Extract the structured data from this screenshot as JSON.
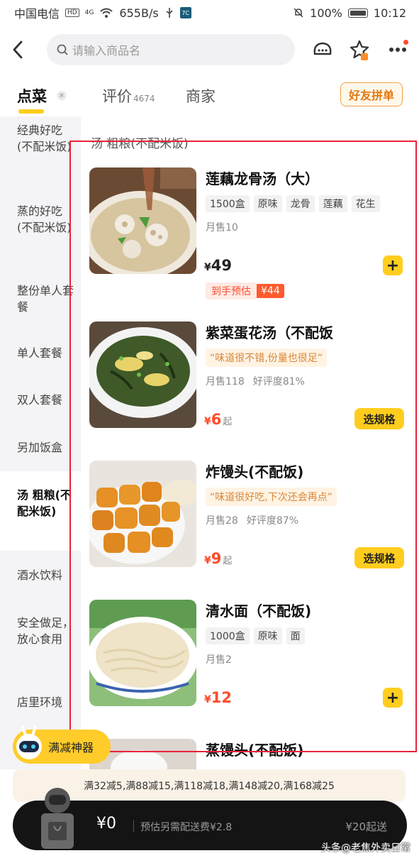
{
  "status_bar": {
    "carrier": "中国电信",
    "hd": "HD",
    "signal_label": "4G",
    "speed": "655B/s",
    "battery": "100%",
    "time": "10:12"
  },
  "search": {
    "placeholder": "请输入商品名"
  },
  "tabs": [
    {
      "label": "点菜"
    },
    {
      "label": "评价",
      "count": "4674"
    },
    {
      "label": "商家"
    }
  ],
  "tab_mini_badge": "不",
  "group_order_label": "好友拼单",
  "sidebar": {
    "items": [
      {
        "label": "经典好吃(不配米饭)"
      },
      {
        "label": "蒸的好吃(不配米饭)"
      },
      {
        "label": "整份单人套餐"
      },
      {
        "label": "单人套餐"
      },
      {
        "label": "双人套餐"
      },
      {
        "label": "另加饭盒"
      },
      {
        "label": "汤 粗粮(不配米饭)",
        "active": true
      },
      {
        "label": "酒水饮料"
      },
      {
        "label": "安全做足，放心食用"
      },
      {
        "label": "店里环境"
      }
    ]
  },
  "section_title": "汤 粗粮(不配米饭)",
  "dishes": [
    {
      "name": "莲藕龙骨汤（大）",
      "tags": [
        "1500盒",
        "原味",
        "龙骨",
        "莲藕",
        "花生"
      ],
      "sales": "月售10",
      "currency": "¥",
      "price": "49",
      "estimate_label": "到手预估",
      "estimate_price": "¥44",
      "action": "plus",
      "image_icon": "lotus-soup-image"
    },
    {
      "name": "紫菜蛋花汤（不配饭",
      "quote": "“味道很不错,份量也很足”",
      "sales": "月售118",
      "rating": "好评度81%",
      "currency": "¥",
      "price": "6",
      "from": "起",
      "action_label": "选规格",
      "image_icon": "seaweed-egg-soup-image"
    },
    {
      "name": "炸馒头(不配饭)",
      "quote": "“味道很好吃,下次还会再点”",
      "sales": "月售28",
      "rating": "好评度87%",
      "currency": "¥",
      "price": "9",
      "from": "起",
      "action_label": "选规格",
      "image_icon": "fried-bun-image"
    },
    {
      "name": "清水面（不配饭)",
      "tags": [
        "1000盒",
        "原味",
        "面"
      ],
      "sales": "月售2",
      "currency": "¥",
      "price": "12",
      "action": "plus",
      "image_icon": "plain-noodle-image"
    },
    {
      "name": "蒸馒头(不配饭)",
      "image_icon": "steamed-bun-image"
    }
  ],
  "helper_label": "满减神器",
  "promo_text": "满32减5,满88减15,满118减18,满148减20,满168减25",
  "cart": {
    "price": "¥0",
    "delivery_fee": "预估另需配送费¥2.8",
    "min_order": "¥20起送"
  },
  "watermark": "头条@老焦外卖日常",
  "colors": {
    "accent": "#ffcd1e",
    "price_red": "#ff4b2b",
    "highlight_box": "#e8233a"
  }
}
